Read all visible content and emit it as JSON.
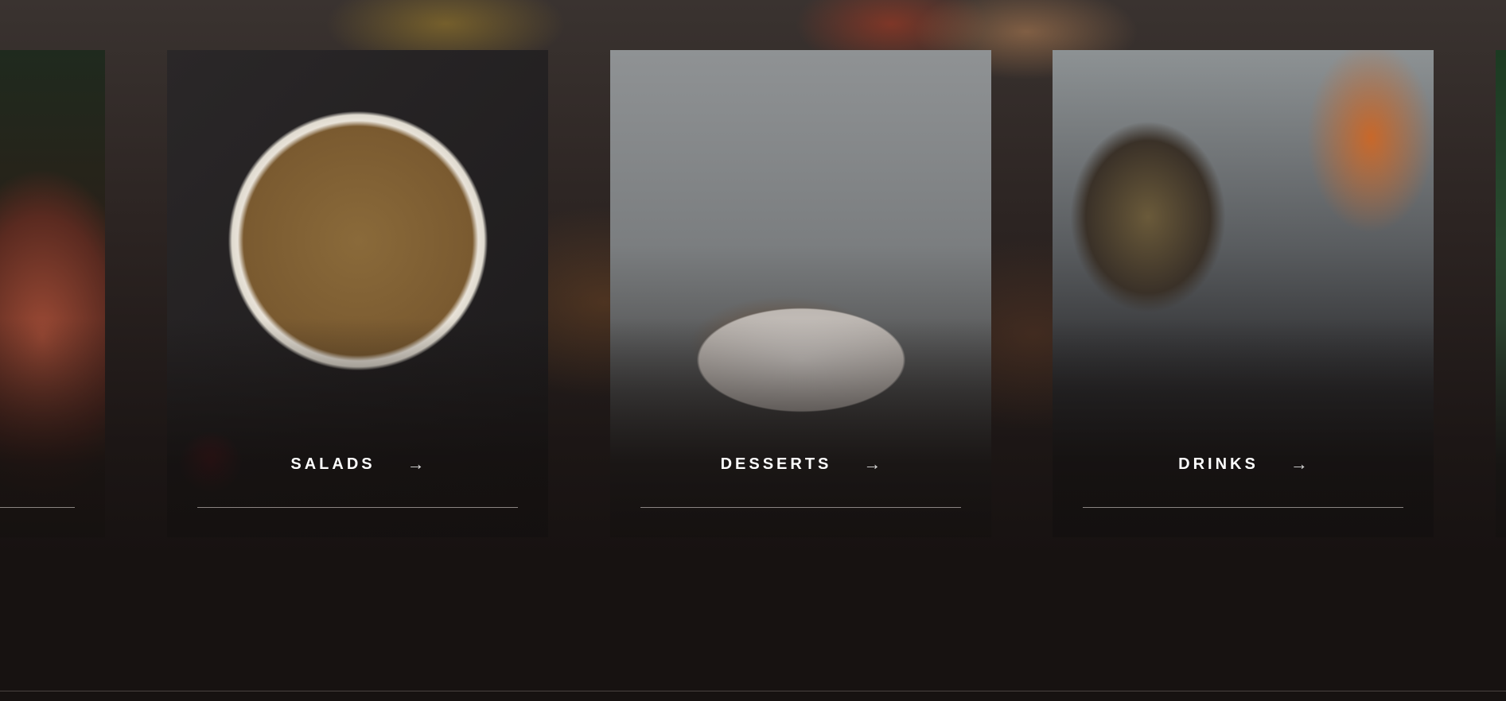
{
  "categories": [
    {
      "label": "",
      "icon": "arrow-right-icon"
    },
    {
      "label": "SALADS",
      "icon": "arrow-right-icon"
    },
    {
      "label": "DESSERTS",
      "icon": "arrow-right-icon"
    },
    {
      "label": "DRINKS",
      "icon": "arrow-right-icon"
    },
    {
      "label": "",
      "icon": "arrow-right-icon"
    }
  ],
  "arrow_glyph": "→"
}
